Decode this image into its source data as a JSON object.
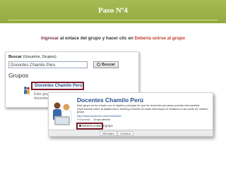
{
  "slide": {
    "title": "Paso Nº4",
    "instruction": {
      "part1": "Ingresar",
      "part2": " al enlace del grupo y hacer clic en ",
      "part3": "Debería unirse al grupo"
    }
  },
  "search_page": {
    "label_bold": "Buscar",
    "label_rest": " (Usuarios, Grupos)",
    "input_value": "Docentes Chamilo Peru",
    "button_label": "Buscar",
    "heading": "Grupos",
    "result": {
      "name": "Docentes Chamilo Perú",
      "description": "Este grupo se ha creado con el objetivo principal de que los docentes..."
    }
  },
  "group_page": {
    "title": "Docentes Chamilo Perú",
    "description": "Este grupo se ha creado con el objetivo principal de que los docentes peruanos puedan intercambiar experiencias sobre la plataforma e-learning Chamilo.Si estas interesa(o) te invitamos a ser parte de nuestro grupo.",
    "link": "http://www.facebook.com/chamiloinv",
    "privacy_label": "Privacidad:",
    "privacy_value": "Grupo abierto",
    "join_label": "Debería unirse al grupo",
    "tabs": [
      "Mensajes",
      "Usuarios"
    ]
  }
}
